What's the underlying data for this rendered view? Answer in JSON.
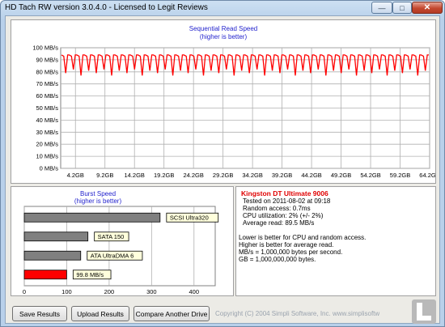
{
  "window": {
    "title": "HD Tach RW version 3.0.4.0 - Licensed to Legit Reviews"
  },
  "sequential_chart": {
    "title": "Sequential Read Speed",
    "subtitle": "(higher is better)"
  },
  "burst_chart": {
    "title": "Burst Speed",
    "subtitle": "(higher is better)"
  },
  "chart_data": [
    {
      "type": "line",
      "title": "Sequential Read Speed",
      "subtitle": "(higher is better)",
      "xlabel": "",
      "ylabel": "",
      "ylim": [
        0,
        100
      ],
      "y_ticks": [
        "0 MB/s",
        "10 MB/s",
        "20 MB/s",
        "30 MB/s",
        "40 MB/s",
        "50 MB/s",
        "60 MB/s",
        "70 MB/s",
        "80 MB/s",
        "90 MB/s",
        "100 MB/s"
      ],
      "x_ticks": [
        "4.2GB",
        "9.2GB",
        "14.2GB",
        "19.2GB",
        "24.2GB",
        "29.2GB",
        "34.2GB",
        "39.2GB",
        "44.2GB",
        "49.2GB",
        "54.2GB",
        "59.2GB",
        "64.2GB"
      ],
      "grid": true,
      "series": [
        {
          "color": "#ff0000",
          "pattern_peak": 94,
          "pattern_troughs": [
            79,
            82,
            77,
            81
          ],
          "cycles": 48
        }
      ]
    },
    {
      "type": "bar",
      "title": "Burst Speed",
      "subtitle": "(higher is better)",
      "orientation": "horizontal",
      "xlim": [
        0,
        450
      ],
      "x_ticks": [
        "0",
        "100",
        "200",
        "300",
        "400"
      ],
      "categories": [
        "SCSI Ultra320",
        "SATA 150",
        "ATA UltraDMA 6",
        "99.8 MB/s"
      ],
      "values": [
        320,
        150,
        133,
        99.8
      ],
      "colors": [
        "#808080",
        "#808080",
        "#808080",
        "#ff0000"
      ]
    }
  ],
  "info": {
    "drive_name": "Kingston DT Ultimate 9006",
    "tested_on": "Tested on 2011-08-02 at 09:18",
    "random_access": "Random access: 0.7ms",
    "cpu": "CPU utilization: 2% (+/- 2%)",
    "average": "Average read: 89.5 MB/s",
    "note1": "Lower is better for CPU and random access.",
    "note2": "Higher is better for average read.",
    "note3": "MB/s = 1,000,000 bytes per second.",
    "note4": "GB = 1,000,000,000 bytes."
  },
  "buttons": {
    "save": "Save Results",
    "upload": "Upload Results",
    "compare": "Compare Another Drive"
  },
  "footer": {
    "copyright": "Copyright (C) 2004 Simpli Software, Inc. www.simplisoftw"
  },
  "colors": {
    "line": "#ff0000",
    "axis_title": "#1f1fcc",
    "bar_gray": "#808080",
    "bar_red": "#ff0000",
    "drive_name": "#e00000"
  }
}
